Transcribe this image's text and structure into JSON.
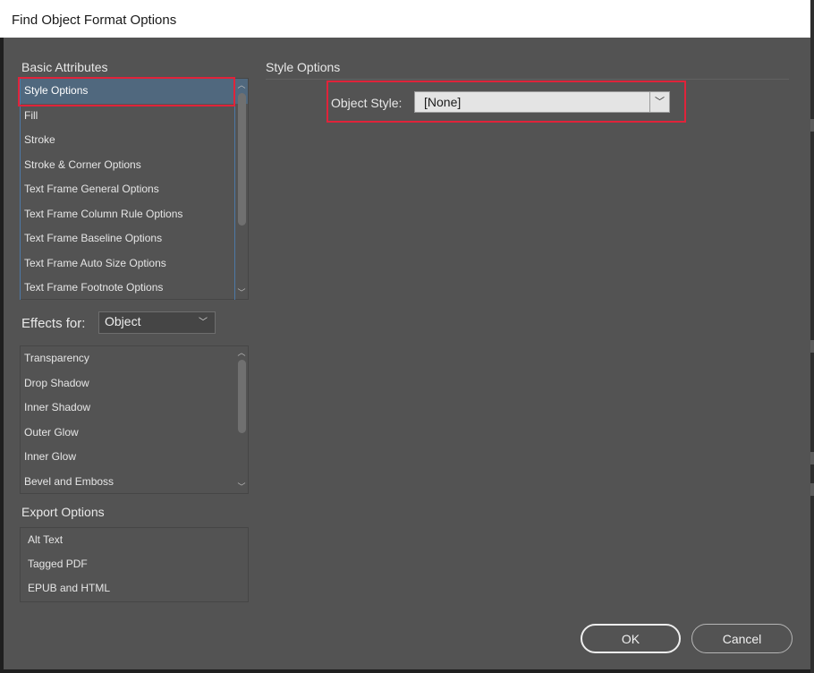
{
  "window": {
    "title": "Find Object Format Options"
  },
  "basic_attributes": {
    "heading": "Basic Attributes",
    "items": [
      "Style Options",
      "Fill",
      "Stroke",
      "Stroke & Corner Options",
      "Text Frame General Options",
      "Text Frame Column Rule Options",
      "Text Frame Baseline Options",
      "Text Frame Auto Size Options",
      "Text Frame Footnote Options"
    ],
    "selected": "Style Options"
  },
  "effects": {
    "label": "Effects for:",
    "target": "Object",
    "items": [
      "Transparency",
      "Drop Shadow",
      "Inner Shadow",
      "Outer Glow",
      "Inner Glow",
      "Bevel and Emboss"
    ]
  },
  "export_options": {
    "heading": "Export Options",
    "items": [
      "Alt Text",
      "Tagged PDF",
      "EPUB and HTML"
    ]
  },
  "style_options": {
    "heading": "Style Options",
    "object_style_label": "Object Style:",
    "object_style_value": "[None]"
  },
  "buttons": {
    "ok": "OK",
    "cancel": "Cancel"
  },
  "colors": {
    "dialog_bg": "#535353",
    "selection": "#50687e",
    "highlight_box": "#e0233a"
  },
  "icons": {
    "dropdown_chevron": "chevron-down-icon",
    "scroll_up": "scroll-up-icon",
    "scroll_down": "scroll-down-icon"
  }
}
